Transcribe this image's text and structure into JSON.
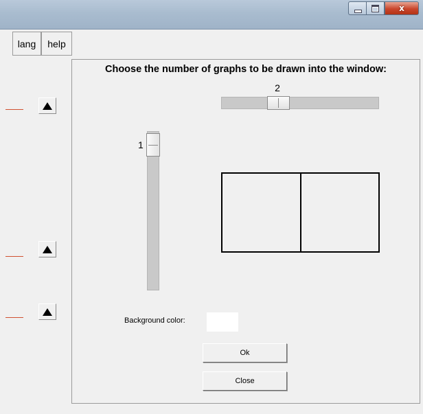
{
  "window": {
    "controls": {
      "minimize_icon": "minimize-icon",
      "maximize_icon": "maximize-icon",
      "close_glyph": "x"
    }
  },
  "menu": {
    "lang_label": "lang",
    "help_label": "help"
  },
  "left_pane": {
    "arrow_icon": "triangle-up-icon",
    "line_color": "#d05030"
  },
  "dialog": {
    "title": "Choose the number of graphs to be drawn into the window:",
    "columns_value": "2",
    "rows_value": "1",
    "columns_fraction": 0.25,
    "rows_fraction": 0.0,
    "preview": {
      "rows": 1,
      "columns": 2
    },
    "background_label": "Background color:",
    "background_color": "#ffffff",
    "ok_label": "Ok",
    "close_label": "Close"
  }
}
